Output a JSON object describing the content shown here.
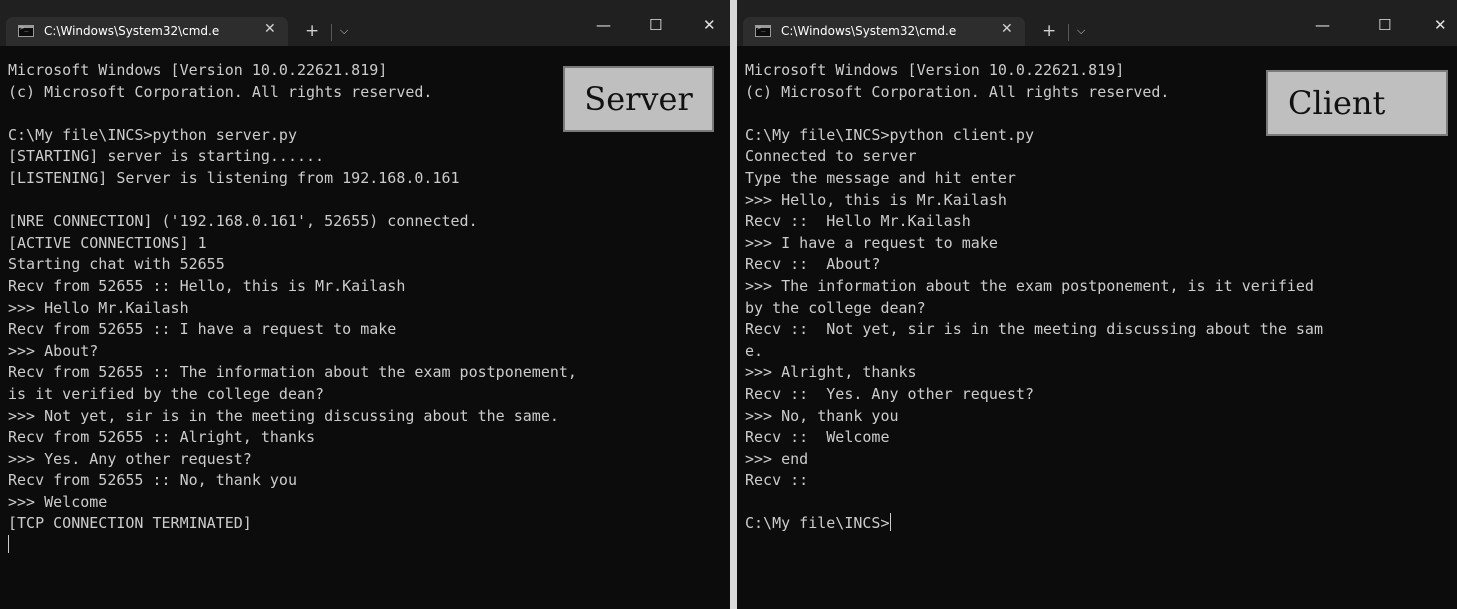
{
  "server_window": {
    "tab_title": "C:\\Windows\\System32\\cmd.e",
    "close_tab_glyph": "✕",
    "new_tab_glyph": "+",
    "dropdown_glyph": "⌵",
    "minimize_glyph": "—",
    "maximize_glyph": "☐",
    "close_glyph": "✕",
    "label": "Server",
    "lines": [
      "Microsoft Windows [Version 10.0.22621.819]",
      "(c) Microsoft Corporation. All rights reserved.",
      "",
      "C:\\My file\\INCS>python server.py",
      "[STARTING] server is starting......",
      "[LISTENING] Server is listening from 192.168.0.161",
      "",
      "[NRE CONNECTION] ('192.168.0.161', 52655) connected.",
      "[ACTIVE CONNECTIONS] 1",
      "Starting chat with 52655",
      "Recv from 52655 :: Hello, this is Mr.Kailash",
      ">>> Hello Mr.Kailash",
      "Recv from 52655 :: I have a request to make",
      ">>> About?",
      "Recv from 52655 :: The information about the exam postponement,",
      "is it verified by the college dean?",
      ">>> Not yet, sir is in the meeting discussing about the same.",
      "Recv from 52655 :: Alright, thanks",
      ">>> Yes. Any other request?",
      "Recv from 52655 :: No, thank you",
      ">>> Welcome",
      "[TCP CONNECTION TERMINATED]"
    ],
    "prompt_line": ""
  },
  "client_window": {
    "tab_title": "C:\\Windows\\System32\\cmd.e",
    "close_tab_glyph": "✕",
    "new_tab_glyph": "+",
    "dropdown_glyph": "⌵",
    "minimize_glyph": "—",
    "maximize_glyph": "☐",
    "close_glyph": "✕",
    "label": "Client",
    "lines": [
      "Microsoft Windows [Version 10.0.22621.819]",
      "(c) Microsoft Corporation. All rights reserved.",
      "",
      "C:\\My file\\INCS>python client.py",
      "Connected to server",
      "Type the message and hit enter",
      ">>> Hello, this is Mr.Kailash",
      "Recv ::  Hello Mr.Kailash",
      ">>> I have a request to make",
      "Recv ::  About?",
      ">>> The information about the exam postponement, is it verified",
      "by the college dean?",
      "Recv ::  Not yet, sir is in the meeting discussing about the sam",
      "e.",
      ">>> Alright, thanks",
      "Recv ::  Yes. Any other request?",
      ">>> No, thank you",
      "Recv ::  Welcome",
      ">>> end",
      "Recv ::",
      ""
    ],
    "prompt_line": "C:\\My file\\INCS>"
  }
}
